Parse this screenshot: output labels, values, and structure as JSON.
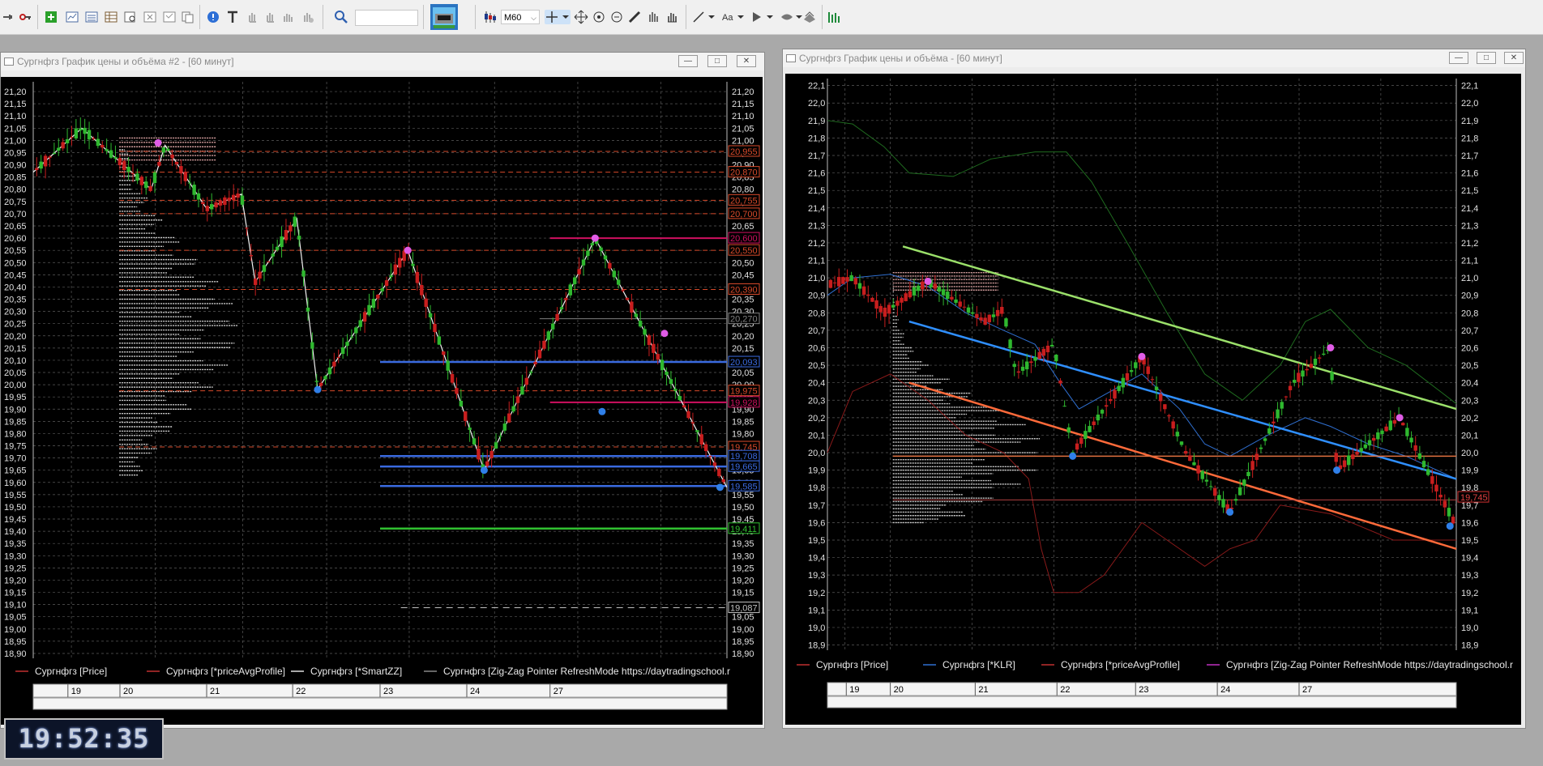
{
  "toolbar": {
    "timeframe": "M60",
    "icons": [
      "connect-icon",
      "key-icon",
      "add-chart-icon",
      "chart-window-icon",
      "quote-window-icon",
      "table-icon",
      "find-icon",
      "settings-icon",
      "close-doc-icon",
      "copy-icon",
      "info-icon",
      "text-icon",
      "hand-icon",
      "hand2-icon",
      "hand3-icon",
      "hand4-icon",
      "search-icon",
      "terminal-app-icon",
      "candles-icon",
      "crosshair-icon",
      "move-icon",
      "zoom-in-icon",
      "zoom-out-icon",
      "ruler-icon",
      "edit-icon",
      "pan-icon",
      "line-icon",
      "text-tool-icon",
      "arrow-tool-icon",
      "eye-icon",
      "layers-icon",
      "indicator-icon"
    ]
  },
  "chart_data": [
    {
      "type": "candlestick",
      "window_title": "Сургнфгз График цены и объёма #2 - [60 минут]",
      "y_ticks": [
        "21,20",
        "21,15",
        "21,10",
        "21,05",
        "21,00",
        "20,95",
        "20,90",
        "20,85",
        "20,80",
        "20,75",
        "20,70",
        "20,65",
        "20,60",
        "20,55",
        "20,50",
        "20,45",
        "20,40",
        "20,35",
        "20,30",
        "20,25",
        "20,20",
        "20,15",
        "20,10",
        "20,05",
        "20,00",
        "19,95",
        "19,90",
        "19,85",
        "19,80",
        "19,75",
        "19,70",
        "19,65",
        "19,60",
        "19,55",
        "19,50",
        "19,45",
        "19,40",
        "19,35",
        "19,30",
        "19,25",
        "19,20",
        "19,15",
        "19,10",
        "19,05",
        "19,00",
        "18,95",
        "18,90"
      ],
      "ylim": [
        18.88,
        21.24
      ],
      "x_labels": [
        "19",
        "20",
        "21",
        "22",
        "23",
        "24",
        "27"
      ],
      "legend": [
        {
          "label": "Сургнфгз [Price]",
          "color": "#c03030"
        },
        {
          "label": "Сургнфгз [*priceAvgProfile]",
          "color": "#c03030"
        },
        {
          "label": "Сургнфгз [*SmartZZ]",
          "color": "#e0e0e0"
        },
        {
          "label": "Сургнфгз [Zig-Zag Pointer RefreshMode https://daytradingschool.r",
          "color": "#888888"
        }
      ],
      "level_labels": [
        {
          "value": 20.955,
          "text": "20,955",
          "color": "#d84a2a"
        },
        {
          "value": 20.87,
          "text": "20,870",
          "color": "#d84a2a"
        },
        {
          "value": 20.755,
          "text": "20,755",
          "color": "#d84a2a"
        },
        {
          "value": 20.7,
          "text": "20,700",
          "color": "#d84a2a"
        },
        {
          "value": 20.6,
          "text": "20,600",
          "color": "#d01060"
        },
        {
          "value": 20.55,
          "text": "20,550",
          "color": "#d84a2a"
        },
        {
          "value": 20.39,
          "text": "20,390",
          "color": "#d84a2a"
        },
        {
          "value": 20.27,
          "text": "20,270",
          "color": "#808080"
        },
        {
          "value": 20.093,
          "text": "20,093",
          "color": "#3a6ae0"
        },
        {
          "value": 19.975,
          "text": "19,975",
          "color": "#d84a2a"
        },
        {
          "value": 19.928,
          "text": "19,928",
          "color": "#d01060"
        },
        {
          "value": 19.745,
          "text": "19,745",
          "color": "#d84a2a"
        },
        {
          "value": 19.708,
          "text": "19,708",
          "color": "#3a6ae0"
        },
        {
          "value": 19.665,
          "text": "19,665",
          "color": "#3a6ae0"
        },
        {
          "value": 19.585,
          "text": "19,585",
          "color": "#3a6ae0"
        },
        {
          "value": 19.411,
          "text": "19,411",
          "color": "#30c030"
        },
        {
          "value": 19.087,
          "text": "19,087",
          "color": "#c0c0c0"
        }
      ],
      "zigzag": [
        {
          "x": 0.0,
          "y": 20.87
        },
        {
          "x": 0.07,
          "y": 21.05
        },
        {
          "x": 0.17,
          "y": 20.8
        },
        {
          "x": 0.19,
          "y": 20.98
        },
        {
          "x": 0.25,
          "y": 20.72
        },
        {
          "x": 0.3,
          "y": 20.78
        },
        {
          "x": 0.32,
          "y": 20.42
        },
        {
          "x": 0.38,
          "y": 20.68
        },
        {
          "x": 0.41,
          "y": 19.98
        },
        {
          "x": 0.54,
          "y": 20.55
        },
        {
          "x": 0.65,
          "y": 19.65
        },
        {
          "x": 0.81,
          "y": 20.6
        },
        {
          "x": 1.0,
          "y": 19.58
        }
      ],
      "markers_top": [
        {
          "x": 0.18,
          "y": 20.99
        },
        {
          "x": 0.54,
          "y": 20.55
        },
        {
          "x": 0.81,
          "y": 20.6
        },
        {
          "x": 0.91,
          "y": 20.21
        }
      ],
      "markers_bottom": [
        {
          "x": 0.41,
          "y": 19.98
        },
        {
          "x": 0.65,
          "y": 19.65
        },
        {
          "x": 0.82,
          "y": 19.89
        },
        {
          "x": 0.99,
          "y": 19.58
        }
      ]
    },
    {
      "type": "candlestick",
      "window_title": "Сургнфгз График цены и объёма - [60 минут]",
      "y_ticks": [
        "22,1",
        "22,0",
        "21,9",
        "21,8",
        "21,7",
        "21,6",
        "21,5",
        "21,4",
        "21,3",
        "21,2",
        "21,1",
        "21,0",
        "20,9",
        "20,8",
        "20,7",
        "20,6",
        "20,5",
        "20,4",
        "20,3",
        "20,2",
        "20,1",
        "20,0",
        "19,9",
        "19,8",
        "19,7",
        "19,6",
        "19,5",
        "19,4",
        "19,3",
        "19,2",
        "19,1",
        "19,0",
        "18,9"
      ],
      "ylim": [
        18.87,
        22.14
      ],
      "x_labels": [
        "19",
        "20",
        "21",
        "22",
        "23",
        "24",
        "27"
      ],
      "last_price_label": "19,745",
      "legend": [
        {
          "label": "Сургнфгз [Price]",
          "color": "#c03030"
        },
        {
          "label": "Сургнфгз [*KLR]",
          "color": "#2f6fd0"
        },
        {
          "label": "Сургнфгз [*priceAvgProfile]",
          "color": "#c03030"
        },
        {
          "label": "Сургнфгз [Zig-Zag Pointer RefreshMode https://daytradingschool.r",
          "color": "#c030c0"
        }
      ],
      "markers_top": [
        {
          "x": 0.16,
          "y": 20.98
        },
        {
          "x": 0.5,
          "y": 20.55
        },
        {
          "x": 0.8,
          "y": 20.6
        },
        {
          "x": 0.91,
          "y": 20.2
        }
      ],
      "markers_bottom": [
        {
          "x": 0.39,
          "y": 19.98
        },
        {
          "x": 0.64,
          "y": 19.66
        },
        {
          "x": 0.81,
          "y": 19.9
        },
        {
          "x": 0.99,
          "y": 19.58
        }
      ]
    }
  ],
  "clock": "19:52:35"
}
